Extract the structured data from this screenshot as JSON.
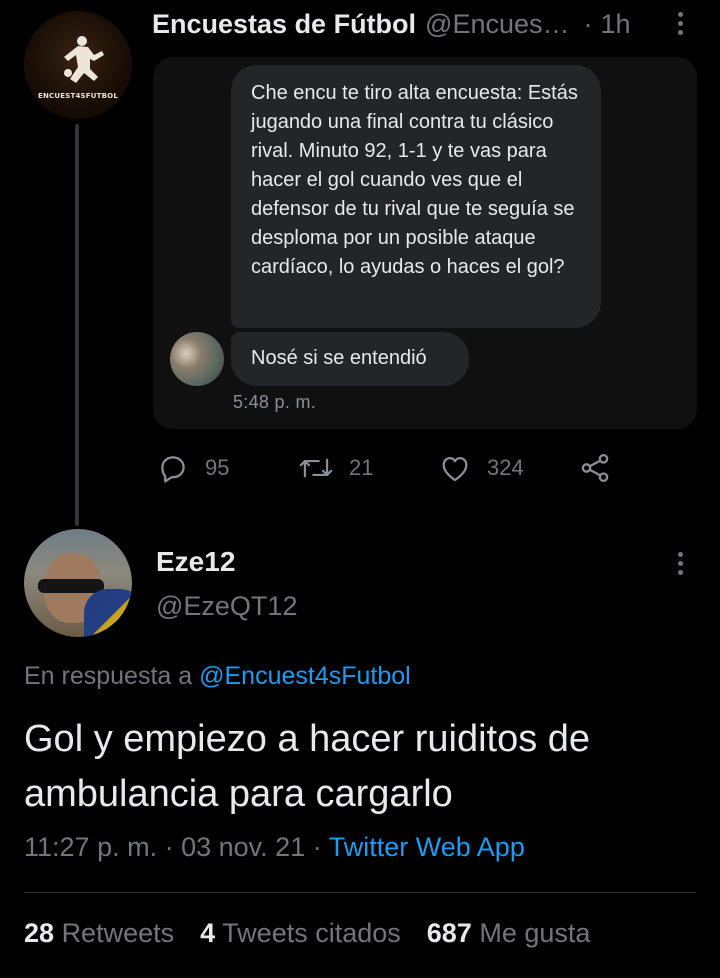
{
  "parent_tweet": {
    "author_name": "Encuestas de Fútbol",
    "author_handle": "@Encues…",
    "separator": "·",
    "time_ago": "1h",
    "avatar_text": "ENCUEST4SFUTBOL",
    "dm": {
      "message_1": "Che encu te tiro alta encuesta: Estás jugando una final contra tu clásico rival. Minuto 92, 1-1 y te vas para hacer el gol cuando ves que el defensor de tu rival que te seguía se desploma por un posible ataque cardíaco, lo ayudas o haces el gol?",
      "message_2": "Nosé si se entendió",
      "timestamp": "5:48 p. m."
    },
    "actions": {
      "replies": "95",
      "retweets": "21",
      "likes": "324"
    }
  },
  "main_tweet": {
    "author_name": "Eze12",
    "author_handle": "@EzeQT12",
    "reply_prefix": "En respuesta a",
    "reply_mention": "@Encuest4sFutbol",
    "text": "Gol y empiezo a hacer ruiditos de ambulancia para cargarlo",
    "time": "11:27 p. m.",
    "separator_1": "·",
    "date": "03 nov. 21",
    "separator_2": "·",
    "source": "Twitter Web App",
    "stats": {
      "retweets_count": "28",
      "retweets_label": "Retweets",
      "quotes_count": "4",
      "quotes_label": "Tweets citados",
      "likes_count": "687",
      "likes_label": "Me gusta"
    }
  },
  "colors": {
    "background": "#000000",
    "text_primary": "#e7e9ea",
    "text_secondary": "#71767b",
    "accent": "#1d9bf0",
    "bubble": "#232528",
    "divider": "#2f3336"
  },
  "icons": [
    "reply-icon",
    "retweet-icon",
    "like-icon",
    "share-icon",
    "more-icon"
  ]
}
